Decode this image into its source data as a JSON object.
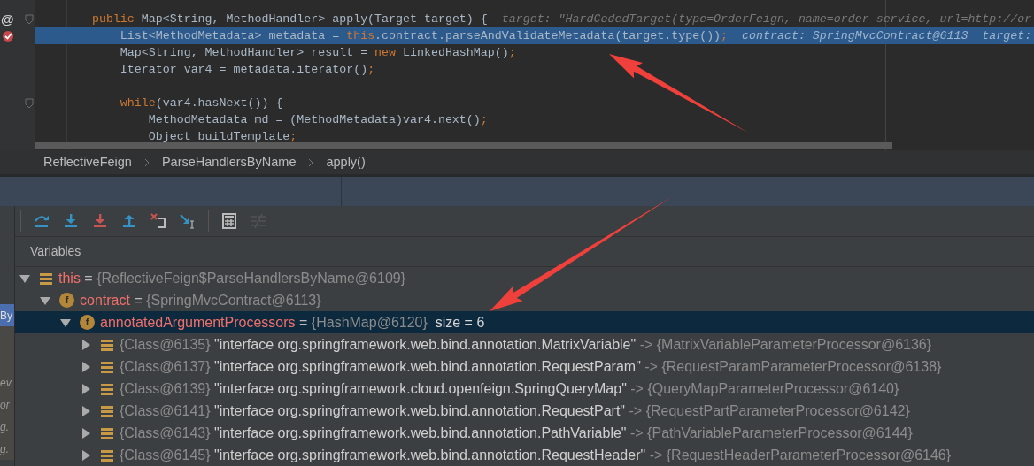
{
  "editor": {
    "lines": [
      {
        "fold": true,
        "current": false,
        "marker": {
          "kind": "override",
          "text": "@"
        },
        "segments": [
          {
            "kind": "keyword",
            "text": "    public "
          },
          {
            "kind": "plain",
            "text": "Map<String, MethodHandler> apply(Target target) {"
          },
          {
            "kind": "hint",
            "text": "  target: \"HardCodedTarget(type=OrderFeign, name=order-service, url=http://or"
          }
        ]
      },
      {
        "current": true,
        "marker": {
          "kind": "breakpoint"
        },
        "segments": [
          {
            "kind": "plain",
            "text": "        List<MethodMetadata> metadata = "
          },
          {
            "kind": "keyword",
            "text": "this"
          },
          {
            "kind": "plain",
            "text": ".contract.parseAndValidateMetadata(target.type())"
          },
          {
            "kind": "keyword",
            "text": ";"
          },
          {
            "kind": "hint",
            "text": "  contract: SpringMvcContract@6113  target:"
          }
        ]
      },
      {
        "current": false,
        "segments": [
          {
            "kind": "plain",
            "text": "        Map<String, MethodHandler> result = "
          },
          {
            "kind": "keyword",
            "text": "new "
          },
          {
            "kind": "plain",
            "text": "LinkedHashMap()"
          },
          {
            "kind": "keyword",
            "text": ";"
          }
        ]
      },
      {
        "current": false,
        "segments": [
          {
            "kind": "plain",
            "text": "        Iterator var4 = metadata.iterator()"
          },
          {
            "kind": "keyword",
            "text": ";"
          }
        ]
      },
      {
        "kind": "blank"
      },
      {
        "fold": true,
        "current": false,
        "segments": [
          {
            "kind": "keyword",
            "text": "        while"
          },
          {
            "kind": "plain",
            "text": "(var4.hasNext()) {"
          }
        ]
      },
      {
        "current": false,
        "segments": [
          {
            "kind": "plain",
            "text": "            MethodMetadata md = (MethodMetadata)var4.next()"
          },
          {
            "kind": "keyword",
            "text": ";"
          }
        ]
      },
      {
        "current": false,
        "segments": [
          {
            "kind": "plain",
            "text": "            Object buildTemplate"
          },
          {
            "kind": "keyword",
            "text": ";"
          }
        ]
      }
    ]
  },
  "breadcrumbs": [
    "ReflectiveFeign",
    "ParseHandlersByName",
    "apply()"
  ],
  "toolbar": [
    {
      "kind": "step-over",
      "disabled": false
    },
    {
      "kind": "step-into",
      "disabled": false
    },
    {
      "kind": "force-step-into",
      "disabled": false
    },
    {
      "kind": "step-out",
      "disabled": false
    },
    {
      "kind": "drop-frame",
      "disabled": false
    },
    {
      "kind": "run-to-cursor",
      "disabled": false
    },
    {
      "kind": "separator"
    },
    {
      "kind": "evaluate",
      "disabled": false
    },
    {
      "kind": "trace",
      "disabled": true
    }
  ],
  "side_fragments": [
    {
      "text": "By",
      "selected": true
    },
    {
      "text": "ev",
      "selected": false
    },
    {
      "text": "or",
      "selected": false
    },
    {
      "text": "g.",
      "selected": false
    },
    {
      "text": "g.",
      "selected": false
    }
  ],
  "variables": {
    "title": "Variables",
    "tree": [
      {
        "kind": "object",
        "name": "this",
        "assign": "=",
        "value": "{ReflectiveFeign$ParseHandlersByName@6109}",
        "expanded": true,
        "selected": false,
        "children": [
          {
            "kind": "field",
            "badge": "f",
            "name": "contract",
            "assign": "=",
            "value": "{SpringMvcContract@6113}",
            "expanded": true,
            "selected": false,
            "children": [
              {
                "kind": "field",
                "badge": "f",
                "name": "annotatedArgumentProcessors",
                "assign": "=",
                "value": "{HashMap@6120}",
                "size": "size = 6",
                "expanded": true,
                "selected": true,
                "children": [
                  {
                    "kind": "entry",
                    "ref": "{Class@6135}",
                    "key": "\"interface org.springframework.web.bind.annotation.MatrixVariable\"",
                    "link": "->",
                    "value": "{MatrixVariableParameterProcessor@6136}",
                    "expanded": false,
                    "selected": false
                  },
                  {
                    "kind": "entry",
                    "ref": "{Class@6137}",
                    "key": "\"interface org.springframework.web.bind.annotation.RequestParam\"",
                    "link": "->",
                    "value": "{RequestParamParameterProcessor@6138}",
                    "expanded": false,
                    "selected": false
                  },
                  {
                    "kind": "entry",
                    "ref": "{Class@6139}",
                    "key": "\"interface org.springframework.cloud.openfeign.SpringQueryMap\"",
                    "link": "->",
                    "value": "{QueryMapParameterProcessor@6140}",
                    "expanded": false,
                    "selected": false
                  },
                  {
                    "kind": "entry",
                    "ref": "{Class@6141}",
                    "key": "\"interface org.springframework.web.bind.annotation.RequestPart\"",
                    "link": "->",
                    "value": "{RequestPartParameterProcessor@6142}",
                    "expanded": false,
                    "selected": false
                  },
                  {
                    "kind": "entry",
                    "ref": "{Class@6143}",
                    "key": "\"interface org.springframework.web.bind.annotation.PathVariable\"",
                    "link": "->",
                    "value": "{PathVariableParameterProcessor@6144}",
                    "expanded": false,
                    "selected": false
                  },
                  {
                    "kind": "entry",
                    "ref": "{Class@6145}",
                    "key": "\"interface org.springframework.web.bind.annotation.RequestHeader\"",
                    "link": "->",
                    "value": "{RequestHeaderParameterProcessor@6146}",
                    "expanded": false,
                    "selected": false
                  }
                ]
              }
            ]
          }
        ]
      }
    ]
  }
}
